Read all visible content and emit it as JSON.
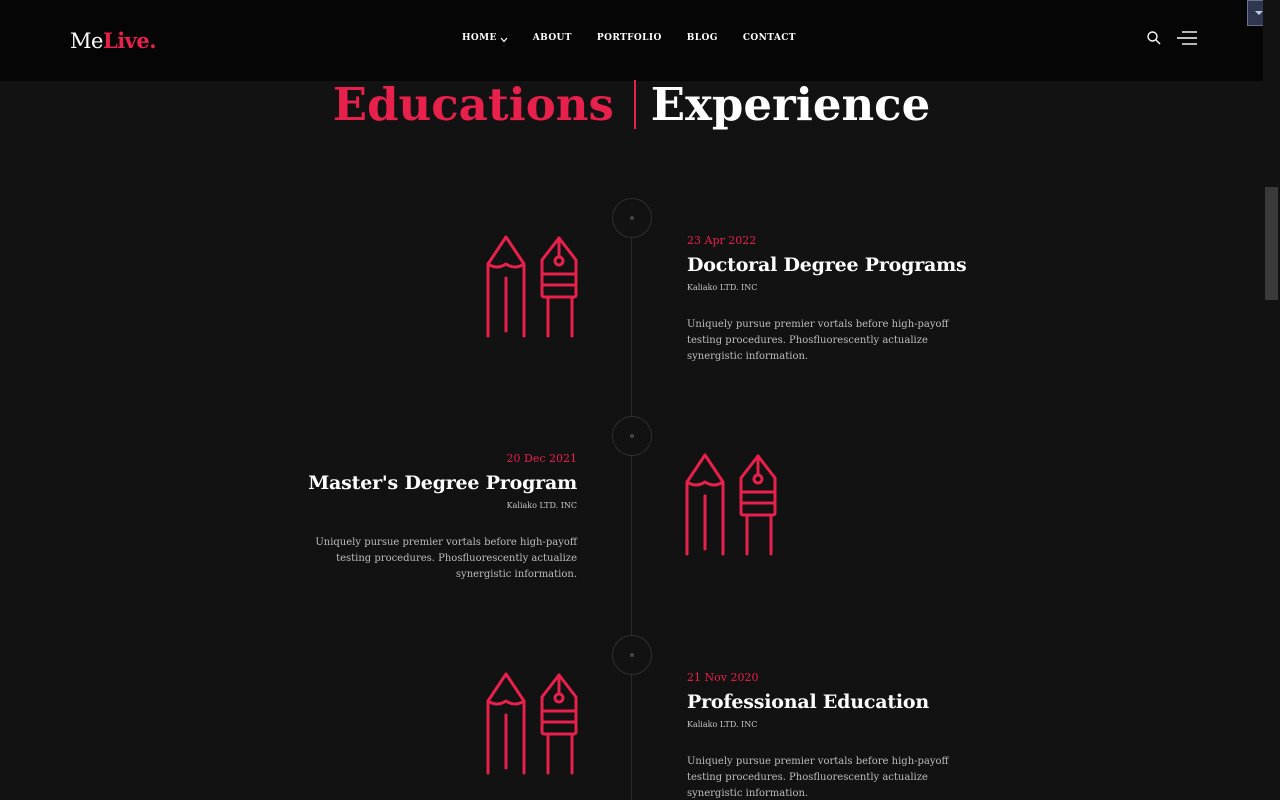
{
  "header": {
    "logo": {
      "me": "Me",
      "live": "Live."
    },
    "nav": [
      {
        "label": "HOME",
        "has_dropdown": true
      },
      {
        "label": "ABOUT"
      },
      {
        "label": "PORTFOLIO"
      },
      {
        "label": "BLOG"
      },
      {
        "label": "CONTACT"
      }
    ],
    "icons": [
      "search-icon",
      "menu-icon"
    ]
  },
  "section": {
    "title_left": "Educations",
    "title_right": "Experience"
  },
  "timeline": [
    {
      "date": "23 Apr 2022",
      "title": "Doctoral Degree Programs",
      "org": "Kaliako LTD. INC",
      "desc": "Uniquely pursue premier vortals before high-payoff testing procedures. Phosfluorescently actualize synergistic information.",
      "side": "right"
    },
    {
      "date": "20 Dec 2021",
      "title": "Master's Degree Program",
      "org": "Kaliako LTD. INC",
      "desc": "Uniquely pursue premier vortals before high-payoff testing procedures. Phosfluorescently actualize synergistic information.",
      "side": "left"
    },
    {
      "date": "21 Nov 2020",
      "title": "Professional Education",
      "org": "Kaliako LTD. INC",
      "desc": "Uniquely pursue premier vortals before high-payoff testing procedures. Phosfluorescently actualize synergistic information.",
      "side": "right"
    }
  ],
  "colors": {
    "accent": "#e8204c",
    "background": "#121212",
    "header_bg": "#050505"
  }
}
